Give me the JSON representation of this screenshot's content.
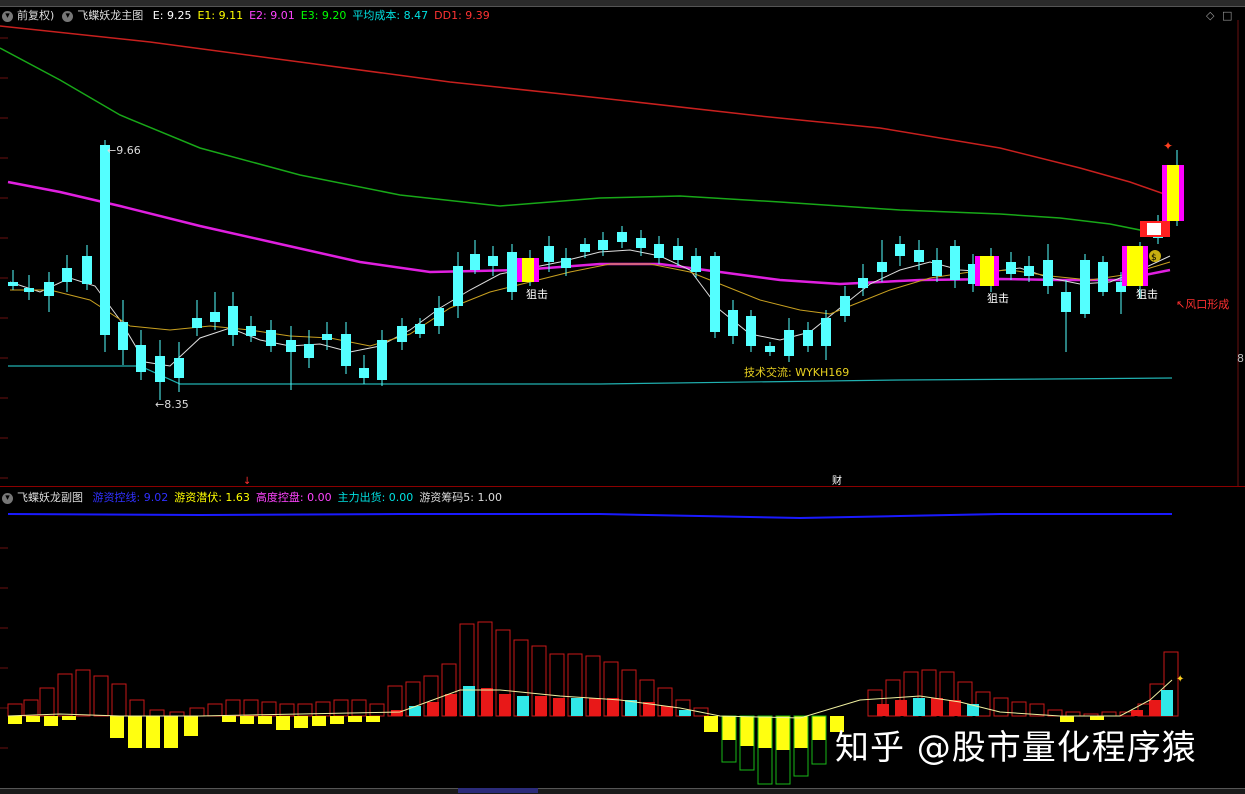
{
  "main_legend": {
    "prefix": "前复权)",
    "title": "飞蝶妖龙主图",
    "items": [
      {
        "label": "E: 9.25",
        "color": "#ffffff"
      },
      {
        "label": "E1: 9.11",
        "color": "#ffff00"
      },
      {
        "label": "E2: 9.01",
        "color": "#ff44ff"
      },
      {
        "label": "E3: 9.20",
        "color": "#00ff00"
      },
      {
        "label": "平均成本: 8.47",
        "color": "#00e0e0"
      },
      {
        "label": "DD1: 9.39",
        "color": "#ff3333"
      }
    ]
  },
  "sub_legend": {
    "title": "飞蝶妖龙副图",
    "items": [
      {
        "label": "游资控线: 9.02",
        "color": "#3030ff"
      },
      {
        "label": "游资潜伏: 1.63",
        "color": "#ffff00"
      },
      {
        "label": "高度控盘: 0.00",
        "color": "#ff44ff"
      },
      {
        "label": "主力出货: 0.00",
        "color": "#00e0e0"
      },
      {
        "label": "游资筹码5: 1.00",
        "color": "#dddddd"
      }
    ]
  },
  "annotations": {
    "high_price": "9.66",
    "low_price": "8.35",
    "snipe_label": "狙击",
    "risk_label": "风口形成",
    "contact_text": "技术交流: WYKH169",
    "finance_marker": "财",
    "small_marker": "8",
    "coin_marker": "$"
  },
  "watermark": "知乎 @股市量化程序猿",
  "colors": {
    "up": "#ff2a2a",
    "down": "#54ffff",
    "ma_red": "#c8201e",
    "ma_green": "#18a818",
    "ma_magenta": "#e020e0",
    "ma_white": "#dddddd",
    "ma_yellow": "#c8a020",
    "cost": "#20b0b0",
    "control_line": "#1a1aff"
  }
}
